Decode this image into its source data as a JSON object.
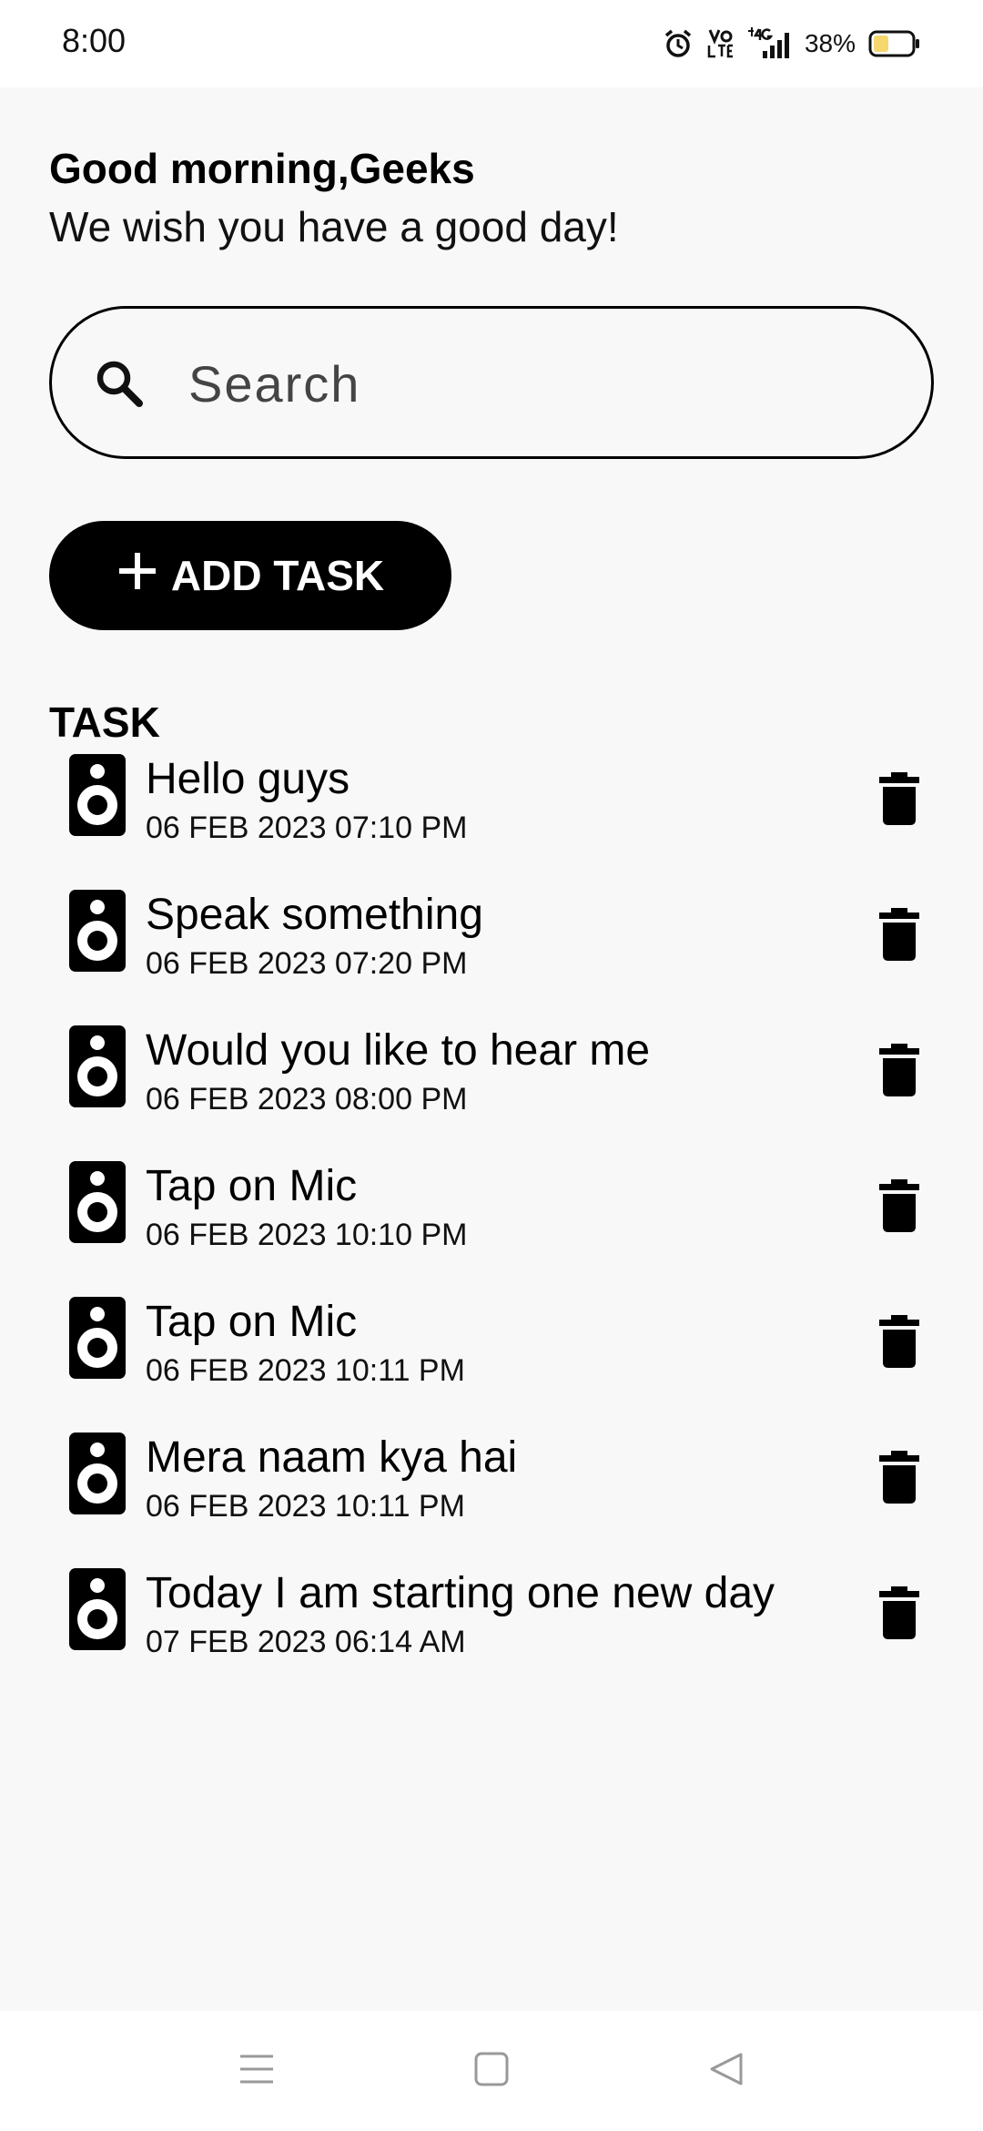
{
  "status_bar": {
    "time": "8:00",
    "battery": "38%",
    "icons": [
      "alarm-icon",
      "volte-icon",
      "4g-signal-icon",
      "battery-icon"
    ]
  },
  "header": {
    "greeting": "Good morning,Geeks",
    "subtitle": "We wish you have a good day!"
  },
  "search": {
    "placeholder": "Search",
    "value": ""
  },
  "add_task": {
    "label": "ADD TASK",
    "icon": "plus-icon"
  },
  "section_title": "TASK",
  "tasks": [
    {
      "title": "Hello guys",
      "date": "06 FEB 2023 07:10 PM"
    },
    {
      "title": "Speak something",
      "date": "06 FEB 2023 07:20 PM"
    },
    {
      "title": "Would you like to hear me",
      "date": "06 FEB 2023 08:00 PM"
    },
    {
      "title": "Tap on Mic",
      "date": "06 FEB 2023 10:10 PM"
    },
    {
      "title": "Tap on Mic",
      "date": "06 FEB 2023 10:11 PM"
    },
    {
      "title": "Mera naam kya hai",
      "date": "06 FEB 2023 10:11 PM"
    },
    {
      "title": "Today I am starting one new day",
      "date": "07 FEB 2023 06:14 AM"
    }
  ],
  "nav": [
    "menu-icon",
    "home-icon",
    "back-icon"
  ],
  "colors": {
    "accent": "#000000",
    "background": "#f8f8f8",
    "battery_fill": "#f5d76e"
  }
}
